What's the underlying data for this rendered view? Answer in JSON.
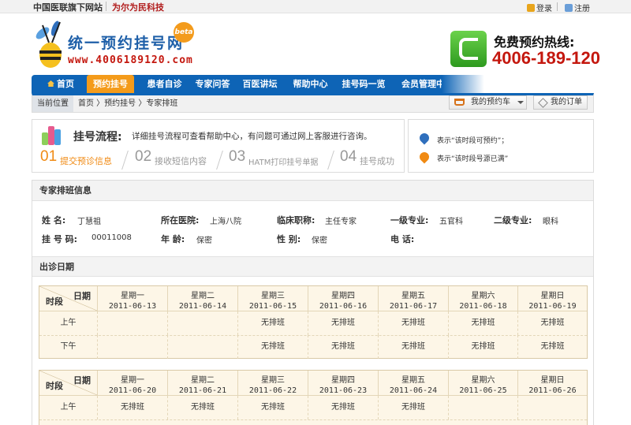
{
  "topbar": {
    "site_text": "中国医联旗下网站",
    "slogan": "为尔为民科技",
    "login": "登录",
    "register": "注册"
  },
  "header": {
    "logo_title": "统一预约挂号网",
    "beta": "beta",
    "logo_url": "www.4006189120.com",
    "hotline_label": "免费预约热线:",
    "hotline_number": "4006-189-120"
  },
  "nav": {
    "items": [
      {
        "label": "首页"
      },
      {
        "label": "预约挂号",
        "active": true
      },
      {
        "label": "患者自诊"
      },
      {
        "label": "专家问答"
      },
      {
        "label": "百医讲坛"
      },
      {
        "label": "帮助中心"
      },
      {
        "label": "挂号码一览"
      },
      {
        "label": "会员管理中心"
      }
    ]
  },
  "breadcrumb": {
    "current_label": "当前位置",
    "path": "首页 〉预约挂号 〉专家排班"
  },
  "toolbar": {
    "cart_label": "我的预约车",
    "order_label": "我的订单"
  },
  "process": {
    "title": "挂号流程:",
    "desc": "详细挂号流程可查看帮助中心，有问题可通过网上客服进行咨询。",
    "steps": [
      {
        "num": "01",
        "text": "提交预诊信息"
      },
      {
        "num": "02",
        "text": "接收短信内容"
      },
      {
        "num": "03",
        "text": "HATM打印挂号单据"
      },
      {
        "num": "04",
        "text": "挂号成功"
      }
    ]
  },
  "legend": {
    "bookable": "表示“该时段可预约”；",
    "full": "表示“该时段号源已满”"
  },
  "colors": {
    "nav_blue": "#0e64b6",
    "active_orange": "#f49b1a",
    "hotline_red": "#c4170e"
  },
  "info": {
    "section_title": "专家排班信息",
    "name_label": "姓    名:",
    "name": "丁慧祖",
    "hospital_label": "所在医院:",
    "hospital": "上海八院",
    "title_label": "临床职称:",
    "title": "主任专家",
    "major1_label": "一级专业:",
    "major1": "五官科",
    "major2_label": "二级专业:",
    "major2": "眼科",
    "code_label": "挂 号 码:",
    "code": "00011008",
    "age_label": "年    龄:",
    "age": "保密",
    "gender_label": "性    别:",
    "gender": "保密",
    "phone_label": "电    话:",
    "phone": ""
  },
  "schedule": {
    "section_title": "出诊日期",
    "corner_day": "日期",
    "corner_slot": "时段",
    "morning": "上午",
    "afternoon": "下午",
    "weeks": [
      {
        "days": [
          {
            "weekday": "星期一",
            "date": "2011-06-13",
            "am": "",
            "pm": ""
          },
          {
            "weekday": "星期二",
            "date": "2011-06-14",
            "am": "",
            "pm": ""
          },
          {
            "weekday": "星期三",
            "date": "2011-06-15",
            "am": "无排班",
            "pm": "无排班"
          },
          {
            "weekday": "星期四",
            "date": "2011-06-16",
            "am": "无排班",
            "pm": "无排班"
          },
          {
            "weekday": "星期五",
            "date": "2011-06-17",
            "am": "无排班",
            "pm": "无排班"
          },
          {
            "weekday": "星期六",
            "date": "2011-06-18",
            "am": "无排班",
            "pm": "无排班"
          },
          {
            "weekday": "星期日",
            "date": "2011-06-19",
            "am": "无排班",
            "pm": "无排班"
          }
        ]
      },
      {
        "days": [
          {
            "weekday": "星期一",
            "date": "2011-06-20",
            "am": "无排班",
            "pm": ""
          },
          {
            "weekday": "星期二",
            "date": "2011-06-21",
            "am": "无排班",
            "pm": ""
          },
          {
            "weekday": "星期三",
            "date": "2011-06-22",
            "am": "无排班",
            "pm": ""
          },
          {
            "weekday": "星期四",
            "date": "2011-06-23",
            "am": "无排班",
            "pm": ""
          },
          {
            "weekday": "星期五",
            "date": "2011-06-24",
            "am": "无排班",
            "pm": ""
          },
          {
            "weekday": "星期六",
            "date": "2011-06-25",
            "am": "",
            "pm": ""
          },
          {
            "weekday": "星期日",
            "date": "2011-06-26",
            "am": "",
            "pm": ""
          }
        ]
      }
    ]
  }
}
